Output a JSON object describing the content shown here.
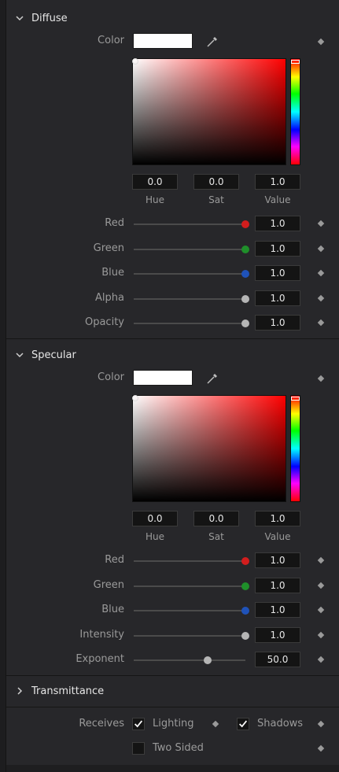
{
  "diffuse": {
    "title": "Diffuse",
    "color_label": "Color",
    "hue": "0.0",
    "sat": "0.0",
    "value": "1.0",
    "hue_label": "Hue",
    "sat_label": "Sat",
    "value_label": "Value",
    "channels": [
      {
        "label": "Red",
        "value": "1.0",
        "knob_color": "#d21d1d",
        "level": 1.0
      },
      {
        "label": "Green",
        "value": "1.0",
        "knob_color": "#1f8f2a",
        "level": 1.0
      },
      {
        "label": "Blue",
        "value": "1.0",
        "knob_color": "#1f52b8",
        "level": 1.0
      },
      {
        "label": "Alpha",
        "value": "1.0",
        "knob_color": "#b5b5b5",
        "level": 1.0
      },
      {
        "label": "Opacity",
        "value": "1.0",
        "knob_color": "#b5b5b5",
        "level": 1.0
      }
    ]
  },
  "specular": {
    "title": "Specular",
    "color_label": "Color",
    "hue": "0.0",
    "sat": "0.0",
    "value": "1.0",
    "hue_label": "Hue",
    "sat_label": "Sat",
    "value_label": "Value",
    "channels": [
      {
        "label": "Red",
        "value": "1.0",
        "knob_color": "#d21d1d",
        "level": 1.0
      },
      {
        "label": "Green",
        "value": "1.0",
        "knob_color": "#1f8f2a",
        "level": 1.0
      },
      {
        "label": "Blue",
        "value": "1.0",
        "knob_color": "#1f52b8",
        "level": 1.0
      },
      {
        "label": "Intensity",
        "value": "1.0",
        "knob_color": "#b5b5b5",
        "level": 1.0
      },
      {
        "label": "Exponent",
        "value": "50.0",
        "knob_color": "#b5b5b5",
        "level": 0.66
      }
    ]
  },
  "transmittance": {
    "title": "Transmittance"
  },
  "options": {
    "receives_label": "Receives",
    "lighting_label": "Lighting",
    "lighting_checked": true,
    "shadows_label": "Shadows",
    "shadows_checked": true,
    "two_sided_label": "Two Sided",
    "two_sided_checked": false
  },
  "icons": {
    "expand": "chevron-down-icon",
    "collapse": "chevron-right-icon",
    "picker": "eyedropper-icon",
    "keyframe": "diamond-icon",
    "check": "checkmark-icon"
  }
}
